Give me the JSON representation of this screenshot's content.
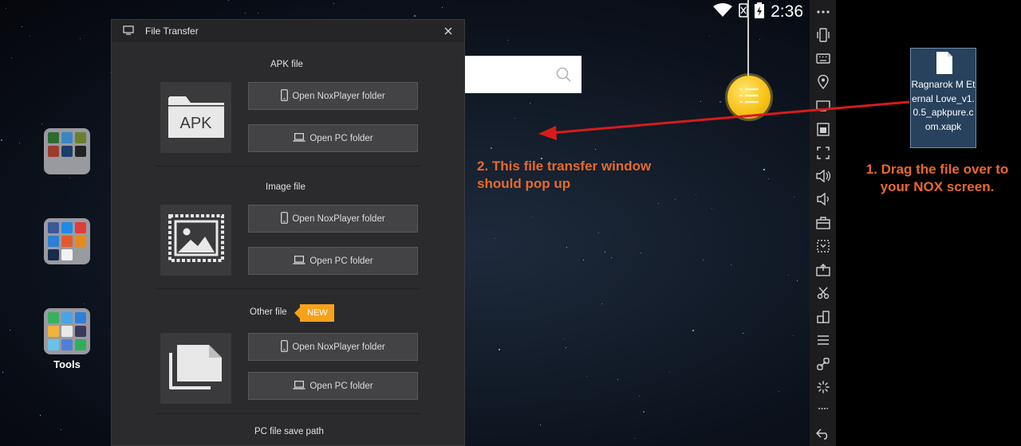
{
  "statusbar": {
    "time": "2:36",
    "wifi_icon": "wifi-icon",
    "battery_icon": "battery-charging-icon"
  },
  "home": {
    "search_icon": "search-icon",
    "folders": [
      {
        "name": "games-folder",
        "label": ""
      },
      {
        "name": "social-folder",
        "label": ""
      },
      {
        "name": "tools-folder",
        "label": "Tools"
      }
    ],
    "floating_ball_icon": "list-icon"
  },
  "dialog": {
    "title": "File Transfer",
    "sections": [
      {
        "title": "APK file",
        "thumb_icon": "apk-folder-icon",
        "thumb_text": "APK",
        "btn_nox": "Open NoxPlayer folder",
        "btn_pc": "Open PC folder"
      },
      {
        "title": "Image file",
        "thumb_icon": "image-icon",
        "btn_nox": "Open NoxPlayer folder",
        "btn_pc": "Open PC folder"
      },
      {
        "title": "Other file",
        "badge": "NEW",
        "thumb_icon": "files-icon",
        "btn_nox": "Open NoxPlayer folder",
        "btn_pc": "Open PC folder"
      }
    ],
    "save_path_title": "PC file save path"
  },
  "annotations": {
    "step2": "2. This file transfer window should pop up",
    "step1": "1. Drag the file over to your NOX screen.",
    "arrow_color": "#d81b1b",
    "text_color": "#e86a2a"
  },
  "toolbar": {
    "icons": [
      "more-icon",
      "phone-shake-icon",
      "keyboard-icon",
      "location-icon",
      "screen-icon",
      "backup-icon",
      "fullscreen-icon",
      "volume-up-icon",
      "volume-down-icon",
      "toolbox-icon",
      "macro-icon",
      "screenshot-icon",
      "scissors-icon",
      "multi-instance-icon",
      "menu-icon",
      "link-icon",
      "loading-icon",
      "recent-icon",
      "back-icon"
    ]
  },
  "desktop": {
    "file_label": "Ragnarok M Eternal Love_v1.0.5_apkpure.com.xapk"
  }
}
